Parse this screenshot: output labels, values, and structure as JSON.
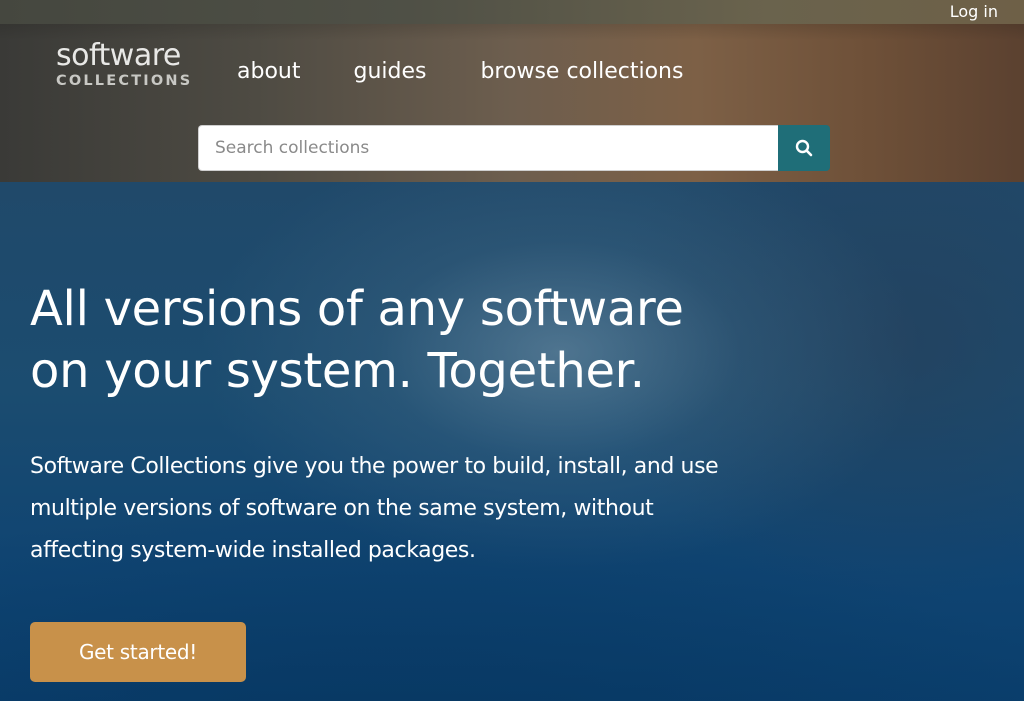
{
  "topbar": {
    "login_label": "Log in"
  },
  "logo": {
    "line1": "software",
    "line2": "COLLECTIONS"
  },
  "nav": {
    "items": [
      {
        "label": "about"
      },
      {
        "label": "guides"
      },
      {
        "label": "browse collections"
      }
    ]
  },
  "search": {
    "placeholder": "Search collections",
    "value": "",
    "button_icon": "search-icon"
  },
  "hero": {
    "title_lines": [
      "All versions of any software",
      "on your system. Together."
    ],
    "description_lines": [
      "Software Collections give you the power to build, install, and use",
      "multiple versions of software on the same system, without",
      "affecting system-wide installed packages."
    ],
    "cta_label": "Get started!"
  },
  "colors": {
    "accent_teal": "#1f6e78",
    "cta_gold": "#c8914a",
    "hero_blue": "#0f4472"
  }
}
